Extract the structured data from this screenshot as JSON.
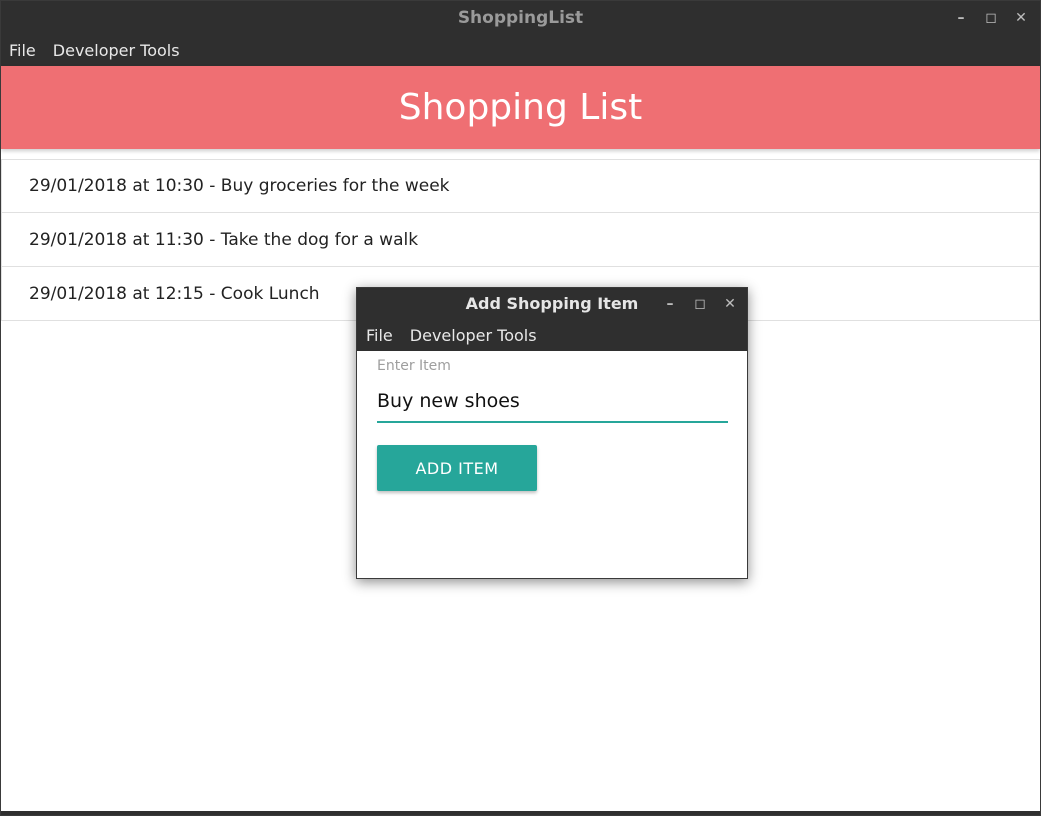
{
  "main_window": {
    "title": "ShoppingList",
    "controls": {
      "minimize": "–",
      "maximize": "◻",
      "close": "✕"
    },
    "menu": [
      "File",
      "Developer Tools"
    ]
  },
  "header": {
    "title": "Shopping List"
  },
  "items": [
    {
      "text": "29/01/2018 at 10:30 - Buy groceries for the week"
    },
    {
      "text": "29/01/2018 at 11:30 - Take the dog for a walk"
    },
    {
      "text": "29/01/2018 at 12:15 - Cook Lunch"
    }
  ],
  "dialog": {
    "title": "Add Shopping Item",
    "controls": {
      "minimize": "–",
      "maximize": "◻",
      "close": "✕"
    },
    "menu": [
      "File",
      "Developer Tools"
    ],
    "field_label": "Enter Item",
    "field_value": "Buy new shoes",
    "button_label": "ADD ITEM"
  },
  "colors": {
    "header": "#ef6f73",
    "accent": "#26a69a",
    "chrome": "#2f2f2f"
  }
}
